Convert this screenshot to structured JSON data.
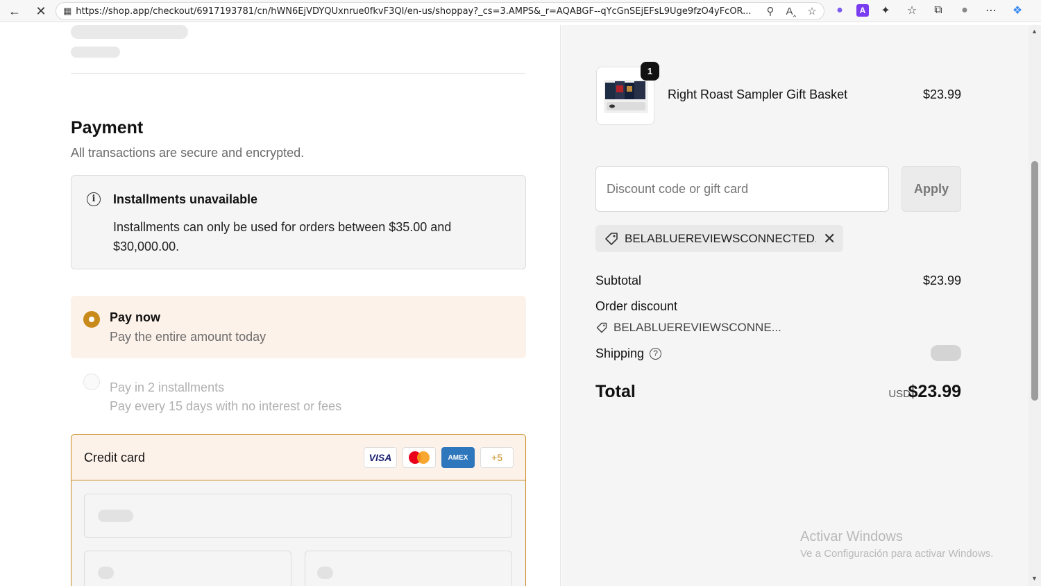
{
  "browser": {
    "url": "https://shop.app/checkout/6917193781/cn/hWN6EjVDYQUxnrue0fkvF3QI/en-us/shoppay?_cs=3.AMPS&_r=AQABGF--qYcGnSEjEFsL9Uge9fzO4yFcOR..."
  },
  "payment": {
    "title": "Payment",
    "subtitle": "All transactions are secure and encrypted.",
    "notice": {
      "title": "Installments unavailable",
      "text": "Installments can only be used for orders between $35.00 and $30,000.00."
    },
    "options": [
      {
        "title": "Pay now",
        "subtitle": "Pay the entire amount today",
        "selected": true
      },
      {
        "title": "Pay in 2 installments",
        "subtitle": "Pay every 15 days with no interest or fees",
        "selected": false
      }
    ],
    "credit_card": {
      "label": "Credit card",
      "brands": [
        "VISA",
        "Mastercard",
        "AMEX"
      ],
      "more": "+5"
    }
  },
  "summary": {
    "product": {
      "quantity": "1",
      "name": "Right Roast Sampler Gift Basket",
      "price": "$23.99"
    },
    "discount_placeholder": "Discount code or gift card",
    "apply_label": "Apply",
    "applied_code": "BELABLUEREVIEWSCONNECTED...",
    "subtotal_label": "Subtotal",
    "subtotal_value": "$23.99",
    "order_discount_label": "Order discount",
    "order_discount_code": "BELABLUEREVIEWSCONNE...",
    "shipping_label": "Shipping",
    "total_label": "Total",
    "total_currency": "USD",
    "total_value": "$23.99"
  },
  "watermark": {
    "line1": "Activar Windows",
    "line2": "Ve a Configuración para activar Windows."
  },
  "colors": {
    "accent": "#c98a1c",
    "accent_bg": "#fdf2ea"
  }
}
